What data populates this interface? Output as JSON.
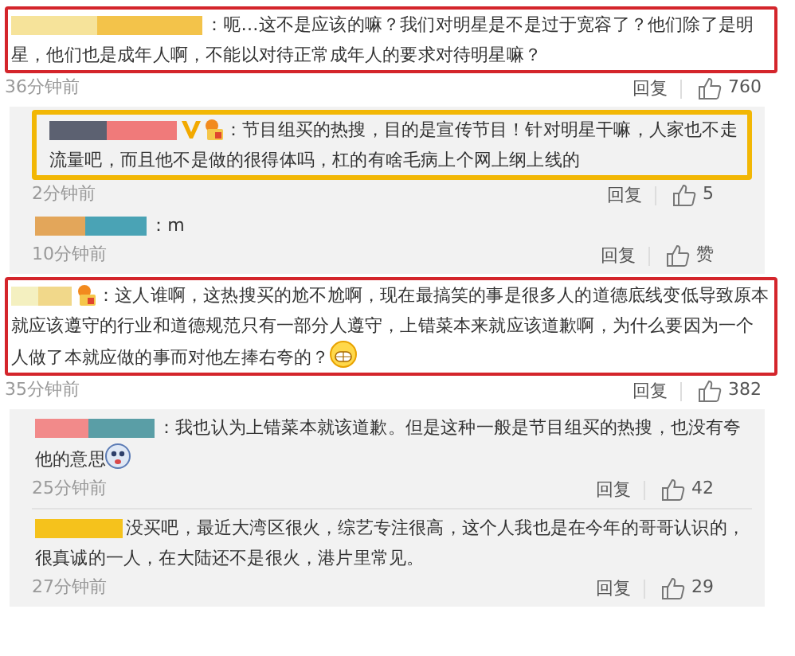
{
  "comments": [
    {
      "frame": {
        "color": "#d4252b"
      },
      "verified": false,
      "medal": false,
      "text": "：呃…这不是应该的嘛？我们对明星是不是过于宽容了？他们除了是明星，他们也是成年人啊，不能以对待正常成年人的要求对待明星嘛？",
      "time": "36分钟前",
      "reply_label": "回复",
      "likes": "760",
      "replies": [
        {
          "frame": {
            "color": "#f2b705"
          },
          "verified": true,
          "medal": true,
          "text": "：节目组买的热搜，目的是宣传节目！针对明星干嘛，人家也不走流量吧，而且他不是做的很得体吗，杠的有啥毛病上个网上纲上线的",
          "time": "2分钟前",
          "reply_label": "回复",
          "likes": "5"
        },
        {
          "verified": false,
          "medal": false,
          "text": "：m",
          "time": "10分钟前",
          "reply_label": "回复",
          "likes": "赞"
        }
      ]
    },
    {
      "frame": {
        "color": "#d4252b"
      },
      "verified": false,
      "medal": true,
      "text": "：这人谁啊，这热搜买的尬不尬啊，现在最搞笑的事是很多人的道德底线变低导致原本就应该遵守的行业和道德规范只有一部分人遵守，上错菜本来就应该道歉啊，为什么要因为一个人做了本就应做的事而对他左捧右夸的？",
      "emoji": {
        "kind": "grin"
      },
      "time": "35分钟前",
      "reply_label": "回复",
      "likes": "382",
      "replies": [
        {
          "verified": false,
          "medal": false,
          "text": "：我也认为上错菜本就该道歉。但是这种一般是节目组买的热搜，也没有夸他的意思",
          "emoji": {
            "kind": "face"
          },
          "time": "25分钟前",
          "reply_label": "回复",
          "likes": "42"
        },
        {
          "verified": false,
          "medal": false,
          "text": "没买吧，最近大湾区很火，综艺专注很高，这个人我也是在今年的哥哥认识的，很真诚的一人，在大陆还不是很火，港片里常见。",
          "time": "27分钟前",
          "reply_label": "回复",
          "likes": "29"
        }
      ]
    }
  ]
}
